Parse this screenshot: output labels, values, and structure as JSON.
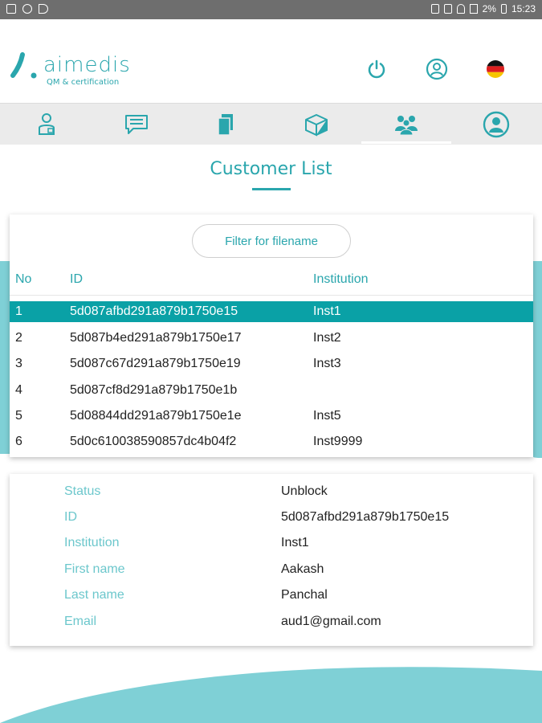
{
  "status_bar": {
    "time": "15:23",
    "battery": "2%"
  },
  "header": {
    "brand": "aimedis",
    "tagline": "QM & certification",
    "power_icon": "power-icon",
    "profile_icon": "user-circle-icon",
    "language_icon": "german-flag-icon"
  },
  "tabs": [
    {
      "name": "doctor-tab",
      "icon": "doctor-icon"
    },
    {
      "name": "messages-tab",
      "icon": "chat-icon"
    },
    {
      "name": "documents-tab",
      "icon": "documents-icon"
    },
    {
      "name": "archive-tab",
      "icon": "box-icon"
    },
    {
      "name": "customers-tab",
      "icon": "group-icon",
      "active": true
    },
    {
      "name": "profile-tab",
      "icon": "user-circle-icon"
    }
  ],
  "page": {
    "title": "Customer List"
  },
  "list": {
    "filter_label": "Filter for filename",
    "headers": {
      "no": "No",
      "id": "ID",
      "institution": "Institution"
    },
    "rows": [
      {
        "no": "1",
        "id": "5d087afbd291a879b1750e15",
        "institution": "Inst1"
      },
      {
        "no": "2",
        "id": "5d087b4ed291a879b1750e17",
        "institution": "Inst2"
      },
      {
        "no": "3",
        "id": "5d087c67d291a879b1750e19",
        "institution": "Inst3"
      },
      {
        "no": "4",
        "id": "5d087cf8d291a879b1750e1b",
        "institution": ""
      },
      {
        "no": "5",
        "id": "5d08844dd291a879b1750e1e",
        "institution": "Inst5"
      },
      {
        "no": "6",
        "id": "5d0c610038590857dc4b04f2",
        "institution": "Inst9999"
      }
    ],
    "selected_index": 0
  },
  "details": {
    "status_label": "Status",
    "status_value": "Unblock",
    "id_label": "ID",
    "id_value": "5d087afbd291a879b1750e15",
    "institution_label": "Institution",
    "institution_value": "Inst1",
    "first_name_label": "First name",
    "first_name_value": "Aakash",
    "last_name_label": "Last name",
    "last_name_value": "Panchal",
    "email_label": "Email",
    "email_value": "aud1@gmail.com"
  },
  "colors": {
    "accent": "#2aa6ad",
    "selected_row": "#0aa1a6",
    "label": "#6cc7cc",
    "tabbar": "#ebebeb"
  }
}
